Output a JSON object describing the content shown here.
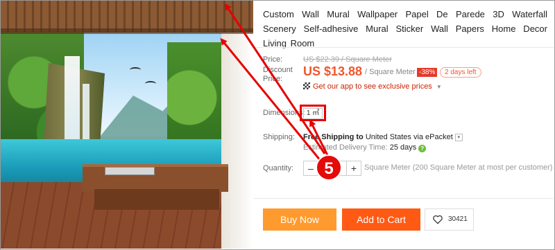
{
  "product": {
    "title": "Custom Wall Mural Wallpaper Papel De Parede 3D Waterfall Scenery Self-adhesive Mural Sticker Wall Papers Home Decor Living Room"
  },
  "pricing": {
    "price_label": "Price:",
    "original_price": "US $22.39 / Square Meter",
    "discount_label": "Discount Price:",
    "discount_price": "US $13.88",
    "unit": "/ Square Meter",
    "discount_badge": "-38%",
    "time_left": "2 days left",
    "app_promo": "Get our app to see exclusive prices"
  },
  "dimensions": {
    "label": "Dimensions:",
    "selected": "1 ㎡"
  },
  "shipping": {
    "label": "Shipping:",
    "free_text": "Free Shipping to",
    "destination": "United States via ePacket",
    "eta_label": "Estimated Delivery Time:",
    "eta_value": "25 days"
  },
  "quantity": {
    "label": "Quantity:",
    "value": "1",
    "minus": "–",
    "plus": "+",
    "note": "Square Meter (200 Square Meter at most per customer)"
  },
  "annotation": {
    "step": "5"
  },
  "actions": {
    "buy_now": "Buy Now",
    "add_to_cart": "Add to Cart",
    "wishlist_count": "30421"
  },
  "colors": {
    "price": "#f2552c",
    "buy_now": "#ff9b2e",
    "add_to_cart": "#ff5a14",
    "annotation": "#e60000"
  }
}
